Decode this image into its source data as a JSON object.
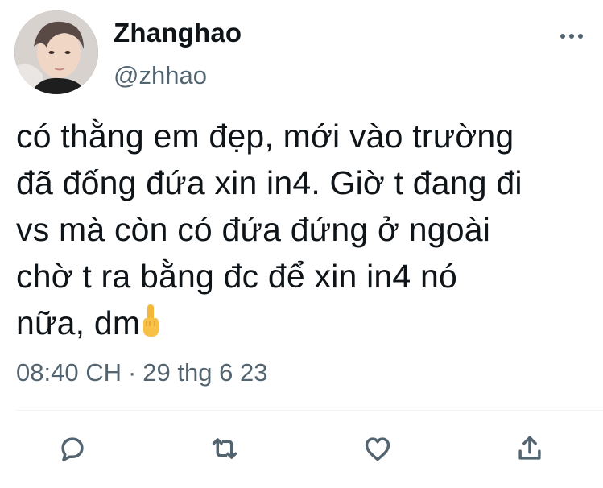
{
  "tweet": {
    "author": {
      "display_name": "Zhanghao",
      "handle": "@zhhao",
      "avatar_icon": "profile-photo"
    },
    "text": "có thằng em đẹp, mới vào trường\nđã đống đứa xin in4. Giờ t đang đi\nvs mà còn có đứa đứng ở ngoài\nchờ t ra bằng đc để xin in4 nó\nnữa, dm",
    "emoji": "middle-finger-emoji",
    "time": "08:40 CH",
    "separator": "·",
    "date": "29 thg 6 23",
    "actions": {
      "reply_icon": "reply-icon",
      "retweet_icon": "retweet-icon",
      "like_icon": "heart-icon",
      "share_icon": "share-icon"
    },
    "colors": {
      "text": "#0f1419",
      "secondary": "#536471",
      "divider": "#eff3f4"
    }
  }
}
